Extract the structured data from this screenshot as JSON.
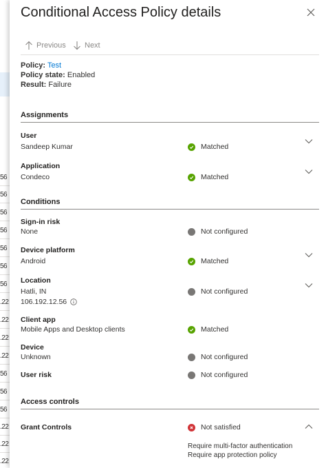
{
  "background": {
    "rows": [
      "56",
      "56",
      "56",
      "56",
      "56",
      "56",
      "56",
      ".22",
      ".22",
      ".22",
      ".22",
      "56",
      "56",
      "56",
      ".22",
      ".22",
      ".22"
    ]
  },
  "panel": {
    "title": "Conditional Access Policy details",
    "nav": {
      "previous": "Previous",
      "next": "Next"
    },
    "summary": {
      "policy_label": "Policy:",
      "policy_value": "Test",
      "state_label": "Policy state:",
      "state_value": "Enabled",
      "result_label": "Result:",
      "result_value": "Failure"
    },
    "assignments": {
      "heading": "Assignments",
      "user": {
        "label": "User",
        "value": "Sandeep Kumar",
        "status": "Matched"
      },
      "application": {
        "label": "Application",
        "value": "Condeco",
        "status": "Matched"
      }
    },
    "conditions": {
      "heading": "Conditions",
      "signin_risk": {
        "label": "Sign-in risk",
        "value": "None",
        "status": "Not configured"
      },
      "device_platform": {
        "label": "Device platform",
        "value": "Android",
        "status": "Matched"
      },
      "location": {
        "label": "Location",
        "value": "Hatli, IN",
        "ip": "106.192.12.56",
        "status": "Not configured"
      },
      "client_app": {
        "label": "Client app",
        "value": "Mobile Apps and Desktop clients",
        "status": "Matched"
      },
      "device": {
        "label": "Device",
        "value": "Unknown",
        "status": "Not configured"
      },
      "user_risk": {
        "label": "User risk",
        "status": "Not configured"
      }
    },
    "access_controls": {
      "heading": "Access controls",
      "grant": {
        "label": "Grant Controls",
        "status": "Not satisfied",
        "requirements": [
          "Require multi-factor authentication",
          "Require app protection policy"
        ]
      }
    }
  },
  "colors": {
    "link": "#0078d4",
    "matched": "#57a300",
    "not_configured": "#797775",
    "not_satisfied": "#d13438"
  },
  "icons": [
    "close-icon",
    "arrow-up-icon",
    "arrow-down-icon",
    "check-icon",
    "chevron-down-icon",
    "chevron-up-icon",
    "info-icon",
    "error-icon"
  ]
}
